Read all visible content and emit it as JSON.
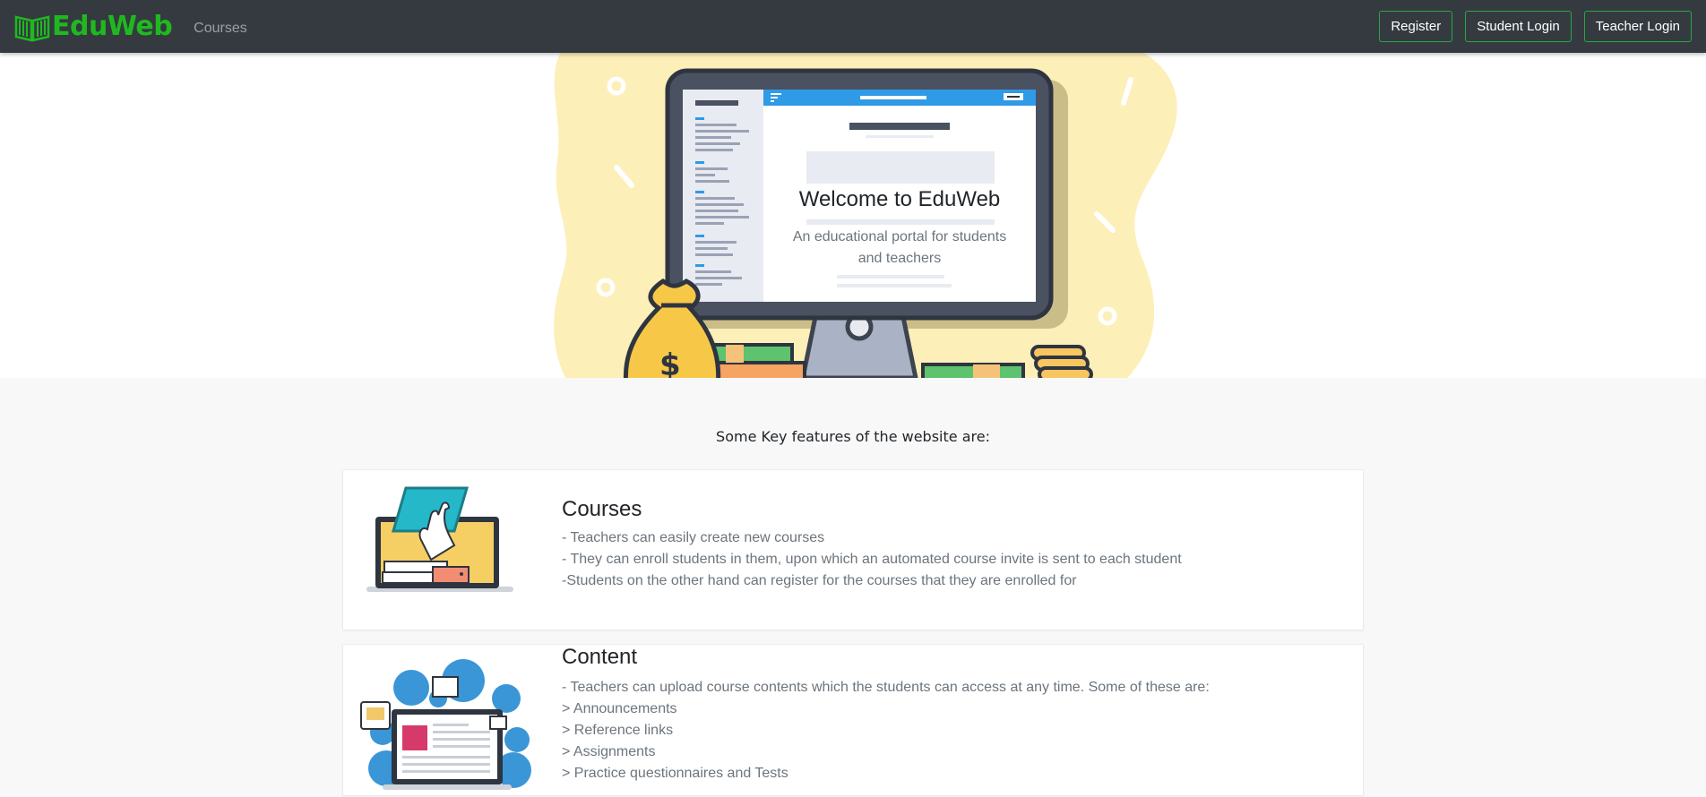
{
  "nav": {
    "brand": "EduWeb",
    "courses_link": "Courses",
    "register": "Register",
    "student_login": "Student Login",
    "teacher_login": "Teacher Login"
  },
  "hero": {
    "title": "Welcome to EduWeb",
    "subtitle": "An educational portal for students and teachers"
  },
  "features": {
    "heading": "Some Key features of the website are:",
    "cards": [
      {
        "title": "Courses",
        "lines": [
          "- Teachers can easily create new courses",
          "- They can enroll students in them, upon which an automated course invite is sent to each student",
          "-Students on the other hand can register for the courses that they are enrolled for"
        ]
      },
      {
        "title": "Content",
        "lines": [
          "- Teachers can upload course contents which the students can access at any time. Some of these are:",
          "> Announcements",
          "> Reference links",
          "> Assignments",
          "> Practice questionnaires and Tests"
        ]
      }
    ]
  },
  "colors": {
    "navbar": "#343a40",
    "brand_green": "#1fb91f",
    "button_border": "#28a745",
    "hero_blob": "#fdefb8",
    "monitor_blue": "#2f9ae6"
  }
}
